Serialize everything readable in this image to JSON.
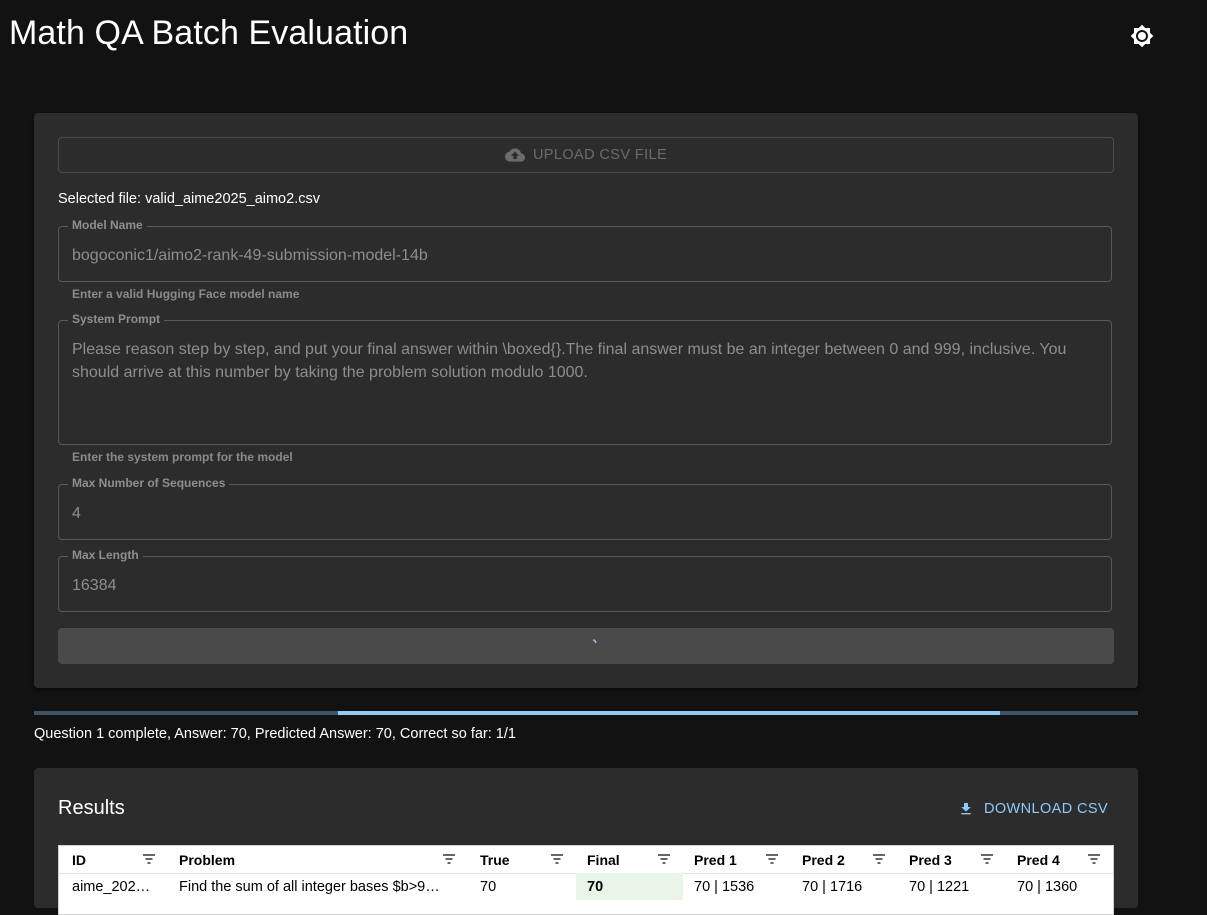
{
  "header": {
    "title": "Math QA Batch Evaluation",
    "theme_icon": "brightness-icon"
  },
  "form": {
    "upload_label": "UPLOAD CSV FILE",
    "selected_file_prefix": "Selected file: ",
    "selected_file": "valid_aime2025_aimo2.csv",
    "model_name": {
      "label": "Model Name",
      "value": "bogoconic1/aimo2-rank-49-submission-model-14b",
      "helper": "Enter a valid Hugging Face model name"
    },
    "system_prompt": {
      "label": "System Prompt",
      "value": "Please reason step by step, and put your final answer within \\boxed{}.The final answer must be an integer between 0 and 999, inclusive. You should arrive at this number by taking the problem solution modulo 1000.",
      "helper": "Enter the system prompt for the model"
    },
    "max_sequences": {
      "label": "Max Number of Sequences",
      "value": "4"
    },
    "max_length": {
      "label": "Max Length",
      "value": "16384"
    }
  },
  "progress": {
    "fraction": 0.6,
    "status": "Question 1 complete, Answer: 70, Predicted Answer: 70, Correct so far: 1/1"
  },
  "results": {
    "title": "Results",
    "download_label": "DOWNLOAD CSV",
    "columns": [
      "ID",
      "Problem",
      "True",
      "Final",
      "Pred 1",
      "Pred 2",
      "Pred 3",
      "Pred 4"
    ],
    "rows": [
      {
        "id": "aime_202…",
        "problem": "Find the sum of all integer bases $b>9…",
        "true": "70",
        "final": "70",
        "pred1": "70 | 1536",
        "pred2": "70 | 1716",
        "pred3": "70 | 1221",
        "pred4": "70 | 1360"
      }
    ]
  },
  "colors": {
    "background": "#121212",
    "card": "#2c2c2c",
    "accent": "#90caf9",
    "final_cell": "#eaf5ea"
  }
}
